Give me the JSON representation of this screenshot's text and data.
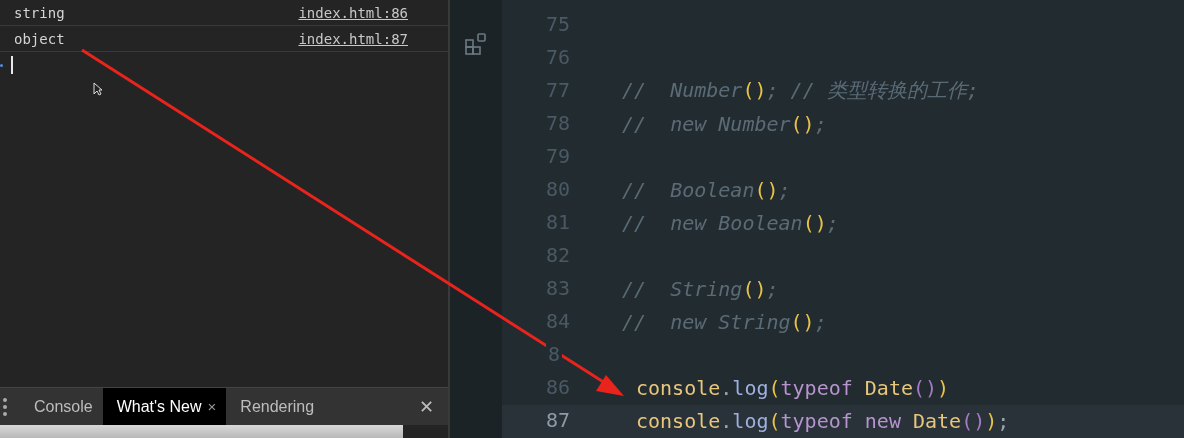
{
  "console": {
    "messages": [
      {
        "text": "string",
        "source": "index.html:86"
      },
      {
        "text": "object",
        "source": "index.html:87"
      }
    ]
  },
  "drawer": {
    "tabs": [
      {
        "label": "Console",
        "selected": false
      },
      {
        "label": "What's New",
        "selected": true,
        "close_icon": "×"
      },
      {
        "label": "Rendering",
        "selected": false
      }
    ],
    "close": "✕"
  },
  "editor": {
    "lines": [
      {
        "number": "75",
        "current": false
      },
      {
        "number": "76",
        "current": false
      },
      {
        "number": "77",
        "current": false,
        "tokens": [
          {
            "kind": "comment",
            "text": "//  Number"
          },
          {
            "kind": "bracket",
            "text": "()"
          },
          {
            "kind": "comment",
            "text": "; // 类型转换的工作;"
          }
        ]
      },
      {
        "number": "78",
        "current": false,
        "tokens": [
          {
            "kind": "comment",
            "text": "//  new Number"
          },
          {
            "kind": "bracket",
            "text": "()"
          },
          {
            "kind": "comment",
            "text": ";"
          }
        ]
      },
      {
        "number": "79",
        "current": false
      },
      {
        "number": "80",
        "current": false,
        "tokens": [
          {
            "kind": "comment",
            "text": "//  Boolean"
          },
          {
            "kind": "bracket",
            "text": "()"
          },
          {
            "kind": "comment",
            "text": ";"
          }
        ]
      },
      {
        "number": "81",
        "current": false,
        "tokens": [
          {
            "kind": "comment",
            "text": "//  new Boolean"
          },
          {
            "kind": "bracket",
            "text": "()"
          },
          {
            "kind": "comment",
            "text": ";"
          }
        ]
      },
      {
        "number": "82",
        "current": false
      },
      {
        "number": "83",
        "current": false,
        "tokens": [
          {
            "kind": "comment",
            "text": "//  String"
          },
          {
            "kind": "bracket",
            "text": "()"
          },
          {
            "kind": "comment",
            "text": ";"
          }
        ]
      },
      {
        "number": "84",
        "current": false,
        "tokens": [
          {
            "kind": "comment",
            "text": "//  new String"
          },
          {
            "kind": "bracket",
            "text": "()"
          },
          {
            "kind": "comment",
            "text": ";"
          }
        ]
      },
      {
        "number": "8",
        "current": false
      },
      {
        "number": "86",
        "current": false,
        "tokens": [
          {
            "kind": "ident",
            "text": "console"
          },
          {
            "kind": "punct",
            "text": "."
          },
          {
            "kind": "method",
            "text": "log"
          },
          {
            "kind": "bracket",
            "text": "("
          },
          {
            "kind": "keyword",
            "text": "typeof"
          },
          {
            "kind": "ident",
            "text": " Date"
          },
          {
            "kind": "inner",
            "text": "()"
          },
          {
            "kind": "bracket",
            "text": ")"
          }
        ]
      },
      {
        "number": "87",
        "current": true,
        "tokens": [
          {
            "kind": "ident",
            "text": "console"
          },
          {
            "kind": "punct",
            "text": "."
          },
          {
            "kind": "method",
            "text": "log"
          },
          {
            "kind": "bracket",
            "text": "("
          },
          {
            "kind": "keyword",
            "text": "typeof new"
          },
          {
            "kind": "ident",
            "text": " Date"
          },
          {
            "kind": "inner",
            "text": "()"
          },
          {
            "kind": "bracket",
            "text": ")"
          },
          {
            "kind": "punct",
            "text": ";"
          }
        ]
      }
    ]
  }
}
